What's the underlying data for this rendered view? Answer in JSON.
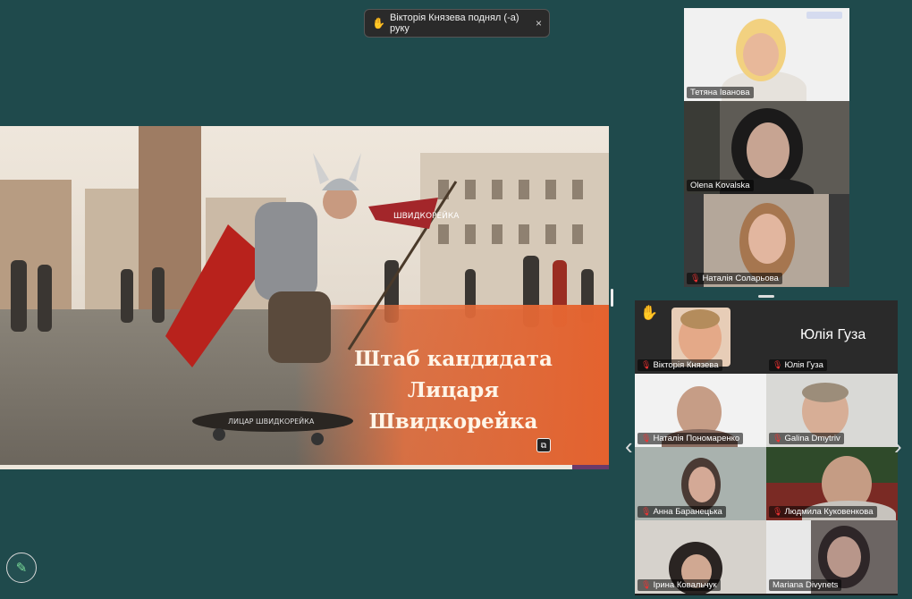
{
  "notification": {
    "icon": "raised-hand-icon",
    "text": "Вікторія Князева поднял (-а) руку",
    "close": "×"
  },
  "slide": {
    "line1": "Штаб кандидата",
    "line2": "Лицаря",
    "line3": "Швидкорейка",
    "flag_text": "ШВИДКОРЕЙКА",
    "board_text": "ЛИЦАР ШВИДКОРЕЙКА"
  },
  "top_strip": [
    {
      "name": "Тетяна Іванова",
      "muted": false
    },
    {
      "name": "Olena Kovalska",
      "muted": false
    },
    {
      "name": "Наталія Соларьова",
      "muted": true
    }
  ],
  "grid": {
    "hand_icon": "✋",
    "speaker_name_big": "Юлія Гуза",
    "tiles": [
      {
        "name": "Вікторія Князева",
        "muted": true
      },
      {
        "name": "Юлія Гуза",
        "muted": true
      },
      {
        "name": "Наталія Пономаренко",
        "muted": true
      },
      {
        "name": "Galina Dmytriv",
        "muted": true
      },
      {
        "name": "Анна Баранецька",
        "muted": true
      },
      {
        "name": "Людмила Куковенкова",
        "muted": true
      },
      {
        "name": "Ірина Ковальчук",
        "muted": true
      },
      {
        "name": "Mariana Divynets",
        "muted": false
      }
    ]
  },
  "icons": {
    "pen": "pen-icon",
    "prev": "chevron-left-icon",
    "next": "chevron-right-icon"
  }
}
